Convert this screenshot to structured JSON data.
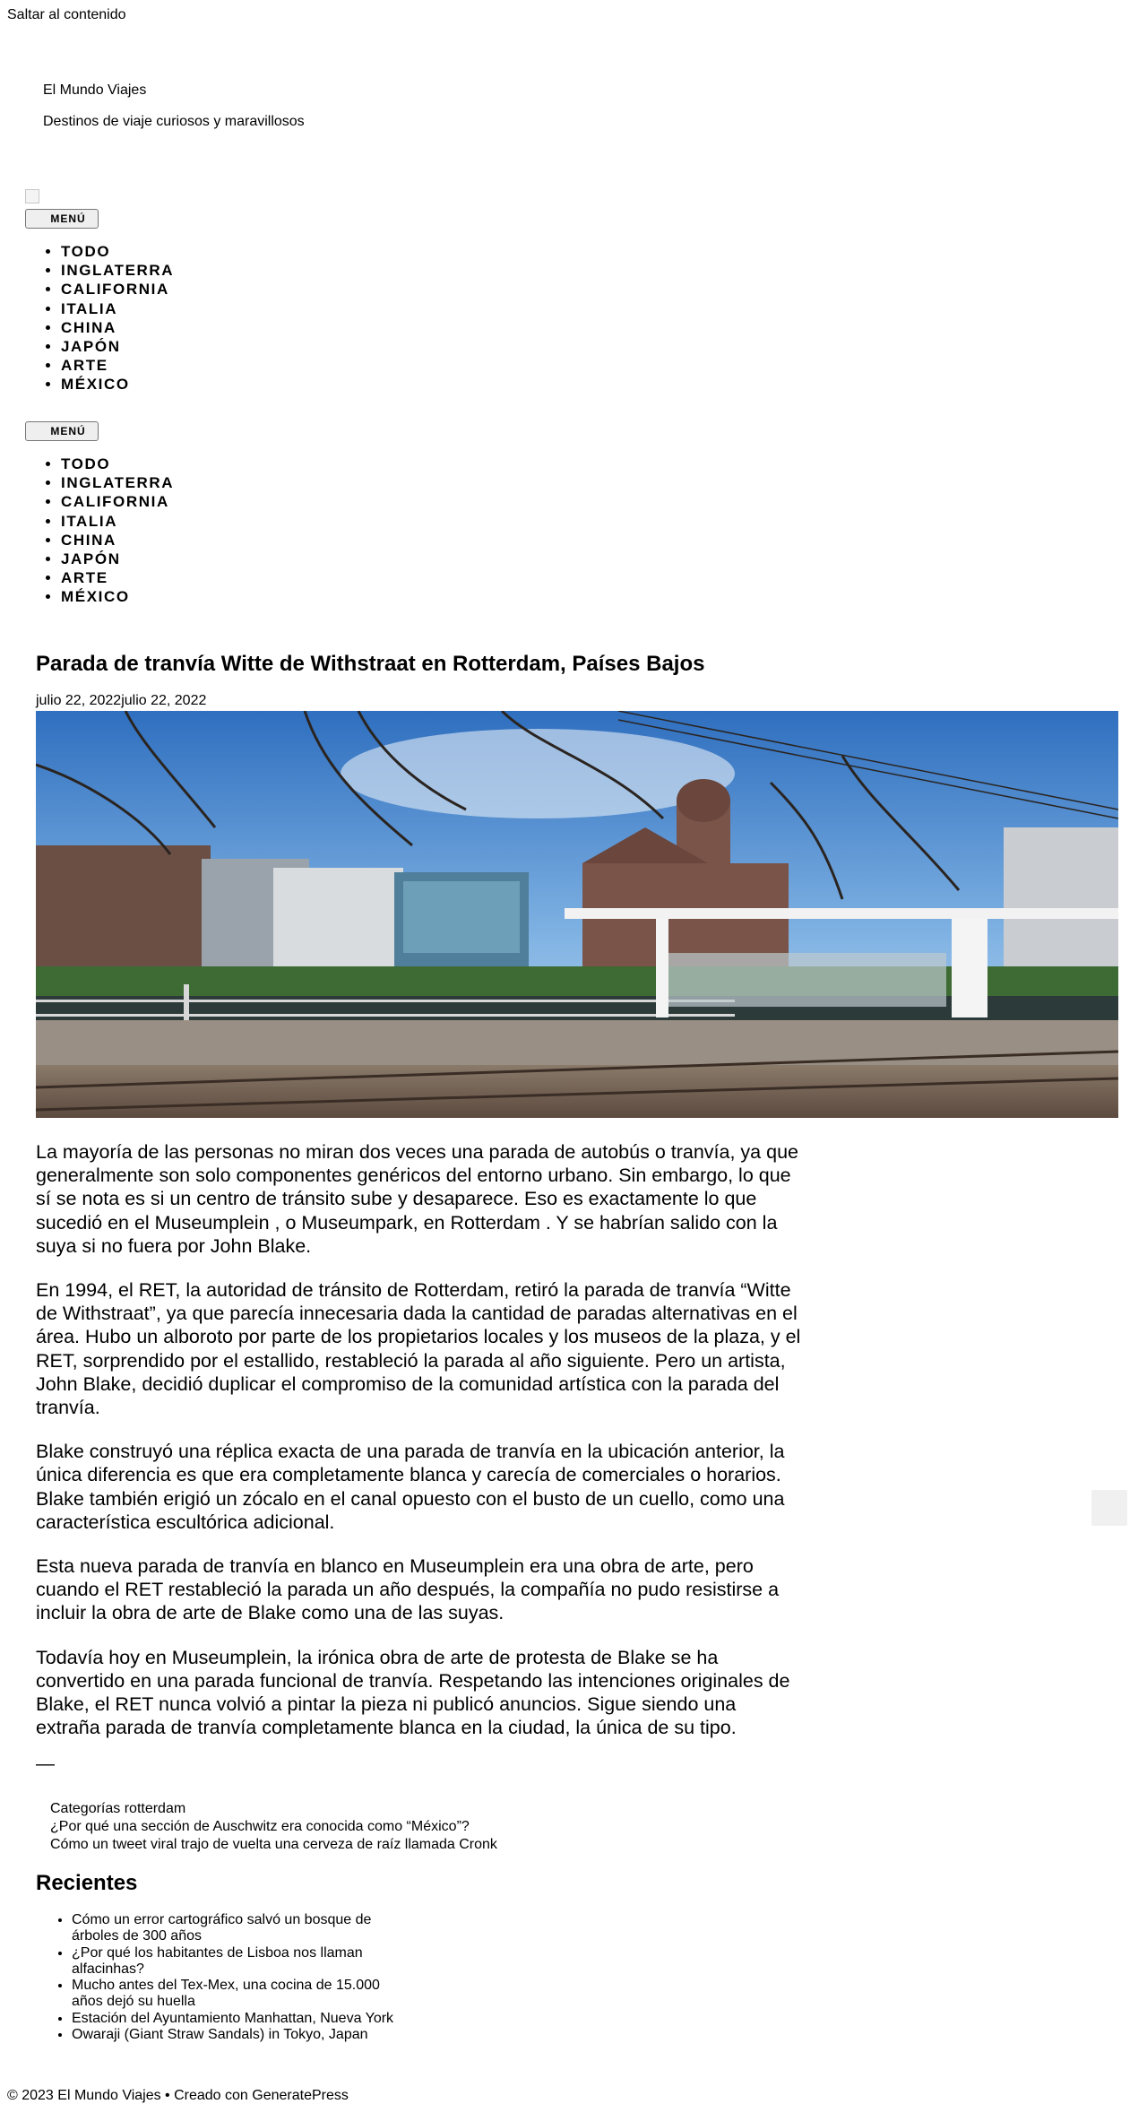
{
  "skip_link": "Saltar al contenido",
  "site": {
    "title": "El Mundo Viajes",
    "description": "Destinos de viaje curiosos y maravillosos"
  },
  "menu": {
    "toggle_label": "MENÚ",
    "items": [
      "TODO",
      "INGLATERRA",
      "CALIFORNIA",
      "ITALIA",
      "CHINA",
      "JAPÓN",
      "ARTE",
      "MÉXICO"
    ]
  },
  "article": {
    "title": "Parada de tranvía Witte de Withstraat en Rotterdam, Países Bajos",
    "date": "julio 22, 2022julio 22, 2022",
    "paragraphs": [
      "La mayoría de las personas no miran dos veces una parada de autobús o tranvía, ya que generalmente son solo componentes genéricos del entorno urbano. Sin embargo, lo que sí se nota es si un centro de tránsito sube y desaparece. Eso es exactamente lo que sucedió en el Museumplein , o Museumpark, en Rotterdam . Y se habrían salido con la suya si no fuera por John Blake.",
      "En 1994, el RET, la autoridad de tránsito de Rotterdam, retiró la parada de tranvía “Witte de Withstraat”, ya que parecía innecesaria dada la cantidad de paradas alternativas en el área. Hubo un alboroto por parte de los propietarios locales y los museos de la plaza, y el RET, sorprendido por el estallido, restableció la parada al año siguiente. Pero un artista, John Blake, decidió duplicar el compromiso de la comunidad artística con la parada del tranvía.",
      "Blake construyó una réplica exacta de una parada de tranvía en la ubicación anterior, la única diferencia es que era completamente blanca y carecía de comerciales o horarios. Blake también erigió un zócalo en el canal opuesto con el busto de un cuello, como una característica escultórica adicional.",
      "Esta nueva parada de tranvía en blanco en Museumplein era una obra de arte, pero cuando el RET restableció la parada un año después, la compañía no pudo resistirse a incluir la obra de arte de Blake como una de las suyas.",
      "Todavía hoy en Museumplein, la irónica obra de arte de protesta de Blake se ha convertido en una parada funcional de tranvía. Respetando las intenciones originales de Blake, el RET nunca volvió a pintar la pieza ni publicó anuncios. Sigue siendo una extraña parada de tranvía completamente blanca en la ciudad, la única de su tipo."
    ],
    "separator": "—",
    "categories": "Categorías rotterdam",
    "prev_post": "¿Por qué una sección de Auschwitz era conocida como “México”?",
    "next_post": "Cómo un tweet viral trajo de vuelta una cerveza de raíz llamada Cronk"
  },
  "sidebar": {
    "recent_title": "Recientes",
    "recent": [
      "Cómo un error cartográfico salvó un bosque de árboles de 300 años",
      "¿Por qué los habitantes de Lisboa nos llaman alfacinhas?",
      "Mucho antes del Tex-Mex, una cocina de 15.000 años dejó su huella",
      "Estación del Ayuntamiento Manhattan, Nueva York",
      "Owaraji (Giant Straw Sandals) in Tokyo, Japan"
    ]
  },
  "footer": "© 2023 El Mundo Viajes • Creado con GeneratePress"
}
